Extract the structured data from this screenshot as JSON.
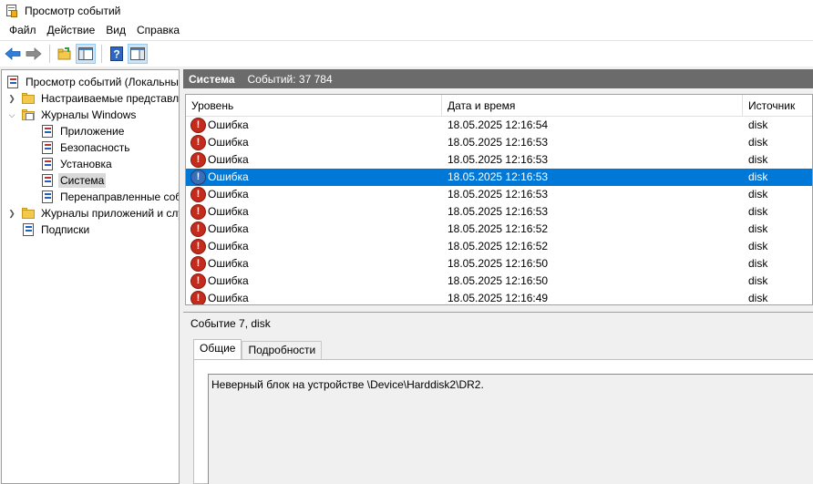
{
  "window": {
    "title": "Просмотр событий"
  },
  "menu": [
    "Файл",
    "Действие",
    "Вид",
    "Справка"
  ],
  "toolbar": {
    "icons": [
      "back-arrow-icon",
      "forward-arrow-icon",
      "open-folder-icon",
      "show-hide-tree-icon",
      "help-icon",
      "show-hide-action-pane-icon"
    ]
  },
  "tree": {
    "root": "Просмотр событий (Локальный)",
    "custom_views": "Настраиваемые представления",
    "windows_logs": "Журналы Windows",
    "logs": [
      "Приложение",
      "Безопасность",
      "Установка",
      "Система",
      "Перенаправленные события"
    ],
    "app_services": "Журналы приложений и служб",
    "subscriptions": "Подписки"
  },
  "header": {
    "name": "Система",
    "count": "Событий: 37 784"
  },
  "columns": {
    "level": "Уровень",
    "datetime": "Дата и время",
    "source": "Источник"
  },
  "events": [
    {
      "level": "Ошибка",
      "datetime": "18.05.2025 12:16:54",
      "source": "disk"
    },
    {
      "level": "Ошибка",
      "datetime": "18.05.2025 12:16:53",
      "source": "disk"
    },
    {
      "level": "Ошибка",
      "datetime": "18.05.2025 12:16:53",
      "source": "disk"
    },
    {
      "level": "Ошибка",
      "datetime": "18.05.2025 12:16:53",
      "source": "disk"
    },
    {
      "level": "Ошибка",
      "datetime": "18.05.2025 12:16:53",
      "source": "disk"
    },
    {
      "level": "Ошибка",
      "datetime": "18.05.2025 12:16:53",
      "source": "disk"
    },
    {
      "level": "Ошибка",
      "datetime": "18.05.2025 12:16:52",
      "source": "disk"
    },
    {
      "level": "Ошибка",
      "datetime": "18.05.2025 12:16:52",
      "source": "disk"
    },
    {
      "level": "Ошибка",
      "datetime": "18.05.2025 12:16:50",
      "source": "disk"
    },
    {
      "level": "Ошибка",
      "datetime": "18.05.2025 12:16:50",
      "source": "disk"
    },
    {
      "level": "Ошибка",
      "datetime": "18.05.2025 12:16:49",
      "source": "disk"
    }
  ],
  "selected_index": 3,
  "details": {
    "title": "Событие 7, disk",
    "tabs": [
      "Общие",
      "Подробности"
    ],
    "description": "Неверный блок на устройстве \\Device\\Harddisk2\\DR2."
  },
  "colors": {
    "selection": "#0078d7",
    "header_bg": "#6b6b6b",
    "error": "#c42b1c"
  }
}
